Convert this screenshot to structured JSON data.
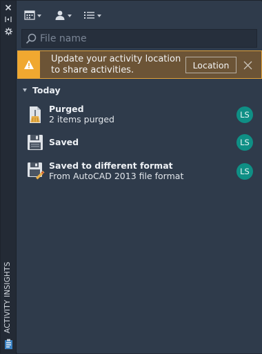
{
  "sidebar": {
    "title": "ACTIVITY INSIGHTS"
  },
  "search": {
    "placeholder": "File name"
  },
  "banner": {
    "message": "Update your activity location to share activities.",
    "button_label": "Location"
  },
  "section": {
    "label": "Today"
  },
  "activities": [
    {
      "title": "Purged",
      "detail": "2 items purged",
      "user": "LS"
    },
    {
      "title": "Saved",
      "detail": "",
      "user": "LS"
    },
    {
      "title": "Saved to different format",
      "detail": "From AutoCAD 2013 file format",
      "user": "LS"
    }
  ],
  "colors": {
    "panel": "#2f3b4b",
    "strip": "#232a35",
    "warning": "#f0a830",
    "banner": "#6c5436",
    "avatar": "#0f8f85"
  }
}
